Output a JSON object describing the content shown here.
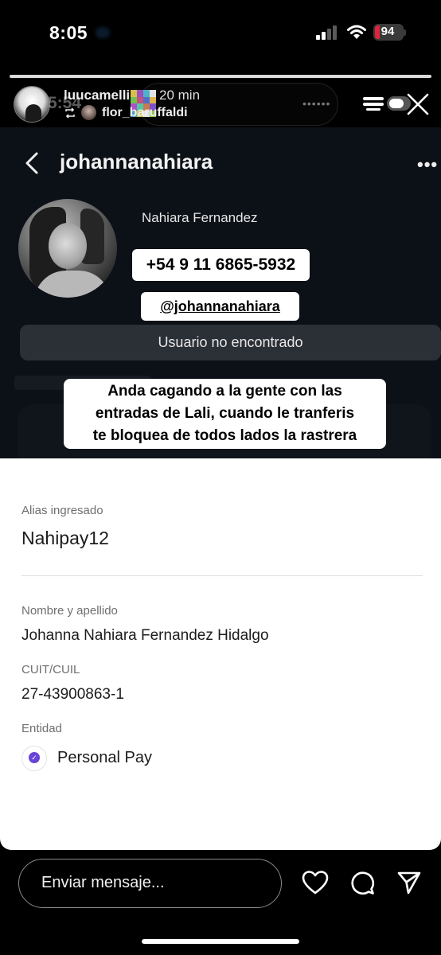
{
  "status_bar": {
    "time": "8:05",
    "battery": "94"
  },
  "story": {
    "progress": 1.0,
    "ghost_time": "5:54",
    "username": "luucamelli",
    "age": "20 min",
    "reposted_from": "flor_baruffaldi",
    "island_dots": "••••••"
  },
  "profile": {
    "username": "johannanahiara",
    "more": "•••",
    "full_name": "Nahiara Fernandez",
    "phone_sticker": "+54 9 11 6865-5932",
    "handle_sticker": "@johannanahiara",
    "not_found": "Usuario no encontrado",
    "comment_line1": "Anda cagando a la gente con las",
    "comment_line2": "entradas de Lali, cuando le tranferis",
    "comment_line3": "te bloquea de todos lados la rastrera"
  },
  "transfer": {
    "alias_label": "Alias ingresado",
    "alias_value": "Nahipay12",
    "name_label": "Nombre y apellido",
    "name_value": "Johanna Nahiara Fernandez Hidalgo",
    "cuit_label": "CUIT/CUIL",
    "cuit_value": "27-43900863-1",
    "entity_label": "Entidad",
    "entity_value": "Personal Pay"
  },
  "bottom_bar": {
    "message_placeholder": "Enviar mensaje..."
  },
  "colors": {
    "profile_bg": "#0c1117",
    "not_found_bg": "#2b2f36",
    "battery_red": "#e0243b",
    "entity_purple": "#6a43d8"
  },
  "icons": [
    "signal-icon",
    "wifi-icon",
    "battery-icon",
    "repost-icon",
    "cast-icon",
    "toggle-icon",
    "close-icon",
    "back-icon",
    "more-icon",
    "check-icon",
    "heart-icon",
    "comment-icon",
    "send-icon"
  ]
}
